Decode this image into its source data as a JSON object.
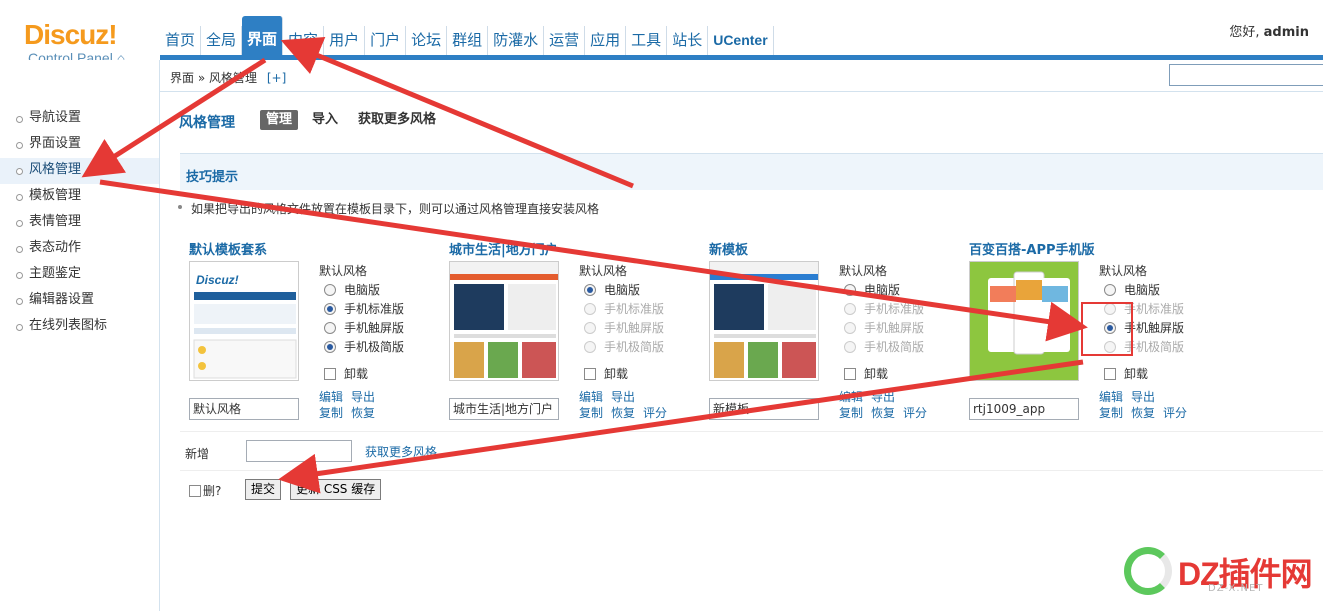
{
  "app": {
    "brand": "Discuz!",
    "sub": "Control Panel"
  },
  "topnav": [
    {
      "label": "首页"
    },
    {
      "label": "全局"
    },
    {
      "label": "界面",
      "active": true
    },
    {
      "label": "内容"
    },
    {
      "label": "用户"
    },
    {
      "label": "门户"
    },
    {
      "label": "论坛"
    },
    {
      "label": "群组"
    },
    {
      "label": "防灌水"
    },
    {
      "label": "运营"
    },
    {
      "label": "应用"
    },
    {
      "label": "工具"
    },
    {
      "label": "站长"
    },
    {
      "label": "UCenter"
    }
  ],
  "welcome": {
    "prefix": "您好,",
    "user": "admin"
  },
  "breadcrumb": {
    "root": "界面",
    "sep": "»",
    "current": "风格管理",
    "plus": "[+]"
  },
  "sidebar": {
    "items": [
      {
        "label": "导航设置"
      },
      {
        "label": "界面设置"
      },
      {
        "label": "风格管理",
        "current": true
      },
      {
        "label": "模板管理"
      },
      {
        "label": "表情管理"
      },
      {
        "label": "表态动作"
      },
      {
        "label": "主题鉴定"
      },
      {
        "label": "编辑器设置"
      },
      {
        "label": "在线列表图标"
      }
    ]
  },
  "main": {
    "title": "风格管理",
    "tabs": [
      {
        "label": "管理",
        "active": true
      },
      {
        "label": "导入"
      },
      {
        "label": "获取更多风格"
      }
    ],
    "tips_title": "技巧提示",
    "tip": "如果把导出的风格文件放置在模板目录下，则可以通过风格管理直接安装风格"
  },
  "styles": [
    {
      "title": "默认模板套系",
      "name": "默认风格",
      "default_label": "默认风格",
      "options": [
        {
          "label": "电脑版",
          "checked": false
        },
        {
          "label": "手机标准版",
          "checked": true
        },
        {
          "label": "手机触屏版",
          "checked": false
        },
        {
          "label": "手机极简版",
          "checked": true
        }
      ],
      "uninstall": "卸载",
      "actions": [
        "编辑",
        "导出",
        "复制",
        "恢复"
      ]
    },
    {
      "title": "城市生活|地方门户",
      "name": "城市生活|地方门户",
      "default_label": "默认风格",
      "options": [
        {
          "label": "电脑版",
          "checked": true
        },
        {
          "label": "手机标准版",
          "disabled": true
        },
        {
          "label": "手机触屏版",
          "disabled": true
        },
        {
          "label": "手机极简版",
          "disabled": true
        }
      ],
      "uninstall": "卸载",
      "actions": [
        "编辑",
        "导出",
        "复制",
        "恢复",
        "评分"
      ]
    },
    {
      "title": "新模板",
      "name": "新模板",
      "default_label": "默认风格",
      "options": [
        {
          "label": "电脑版",
          "checked": false
        },
        {
          "label": "手机标准版",
          "disabled": true
        },
        {
          "label": "手机触屏版",
          "disabled": true
        },
        {
          "label": "手机极简版",
          "disabled": true
        }
      ],
      "uninstall": "卸载",
      "actions": [
        "编辑",
        "导出",
        "复制",
        "恢复",
        "评分"
      ]
    },
    {
      "title": "百变百搭-APP手机版",
      "name": "rtj1009_app",
      "default_label": "默认风格",
      "options": [
        {
          "label": "电脑版",
          "checked": false
        },
        {
          "label": "手机标准版",
          "disabled": true
        },
        {
          "label": "手机触屏版",
          "checked": true
        },
        {
          "label": "手机极简版",
          "disabled": true
        }
      ],
      "uninstall": "卸载",
      "actions": [
        "编辑",
        "导出",
        "复制",
        "恢复",
        "评分"
      ]
    }
  ],
  "new_row": {
    "label": "新增",
    "link": "获取更多风格"
  },
  "submit_row": {
    "delete_label": "删?",
    "submit": "提交",
    "update_cache": "更新 CSS 缓存"
  },
  "watermark": {
    "text": "DZ插件网",
    "small": "DZ-X.NET"
  },
  "colors": {
    "accent": "#2e7fc4",
    "link": "#1b6aa6",
    "annotation": "#e53935",
    "brand": "#f59a1d"
  }
}
